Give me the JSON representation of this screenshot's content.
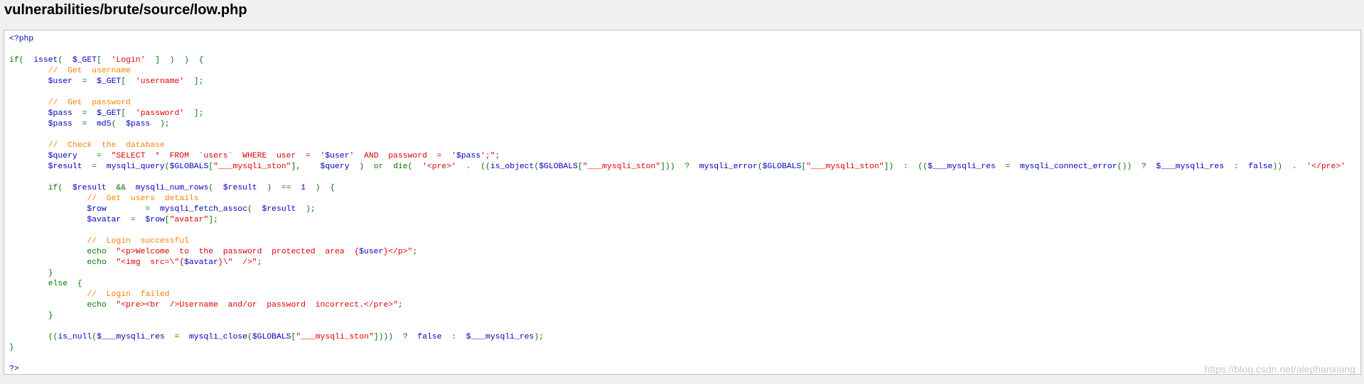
{
  "page": {
    "title": "vulnerabilities/brute/source/low.php"
  },
  "colors": {
    "default": "#0000BB",
    "keyword": "#007700",
    "string": "#DD0000",
    "comment": "#FF8000",
    "background": "#F0F0F0",
    "code_background": "#FFFFFF"
  },
  "code": {
    "lines": [
      [
        [
          "html",
          "&lt;?php"
        ]
      ],
      [],
      [
        [
          "keyword",
          "if(  "
        ],
        [
          "default",
          "isset"
        ],
        [
          "keyword",
          "(  "
        ],
        [
          "default",
          "$_GET"
        ],
        [
          "keyword",
          "[  "
        ],
        [
          "string",
          "'Login'"
        ],
        [
          "keyword",
          "  ]  )  )  {"
        ]
      ],
      [
        [
          "default",
          "        "
        ],
        [
          "comment",
          "//  Get  username"
        ]
      ],
      [
        [
          "default",
          "        $user  "
        ],
        [
          "keyword",
          "=  "
        ],
        [
          "default",
          "$_GET"
        ],
        [
          "keyword",
          "[  "
        ],
        [
          "string",
          "'username'"
        ],
        [
          "keyword",
          "  ];"
        ]
      ],
      [],
      [
        [
          "default",
          "        "
        ],
        [
          "comment",
          "//  Get  password"
        ]
      ],
      [
        [
          "default",
          "        $pass  "
        ],
        [
          "keyword",
          "=  "
        ],
        [
          "default",
          "$_GET"
        ],
        [
          "keyword",
          "[  "
        ],
        [
          "string",
          "'password'"
        ],
        [
          "keyword",
          "  ];"
        ]
      ],
      [
        [
          "default",
          "        $pass  "
        ],
        [
          "keyword",
          "=  "
        ],
        [
          "default",
          "md5"
        ],
        [
          "keyword",
          "(  "
        ],
        [
          "default",
          "$pass  "
        ],
        [
          "keyword",
          ");"
        ]
      ],
      [],
      [
        [
          "default",
          "        "
        ],
        [
          "comment",
          "//  Check  the  database"
        ]
      ],
      [
        [
          "default",
          "        $query    "
        ],
        [
          "keyword",
          "=  "
        ],
        [
          "string",
          "\"SELECT  *  FROM  `users`  WHERE  user  =  '"
        ],
        [
          "default",
          "$user"
        ],
        [
          "string",
          "'  AND  password  =  '"
        ],
        [
          "default",
          "$pass"
        ],
        [
          "string",
          "';\""
        ],
        [
          "keyword",
          ";"
        ]
      ],
      [
        [
          "default",
          "        $result  "
        ],
        [
          "keyword",
          "=  "
        ],
        [
          "default",
          "mysqli_query"
        ],
        [
          "keyword",
          "("
        ],
        [
          "default",
          "$GLOBALS"
        ],
        [
          "keyword",
          "["
        ],
        [
          "string",
          "\"___mysqli_ston\""
        ],
        [
          "keyword",
          "],    "
        ],
        [
          "default",
          "$query  "
        ],
        [
          "keyword",
          ")  or  die(  "
        ],
        [
          "string",
          "'&lt;pre&gt;'  "
        ],
        [
          "keyword",
          ".  (("
        ],
        [
          "default",
          "is_object"
        ],
        [
          "keyword",
          "("
        ],
        [
          "default",
          "$GLOBALS"
        ],
        [
          "keyword",
          "["
        ],
        [
          "string",
          "\"___mysqli_ston\""
        ],
        [
          "keyword",
          "]))  ?  "
        ],
        [
          "default",
          "mysqli_error"
        ],
        [
          "keyword",
          "("
        ],
        [
          "default",
          "$GLOBALS"
        ],
        [
          "keyword",
          "["
        ],
        [
          "string",
          "\"___mysqli_ston\""
        ],
        [
          "keyword",
          "])  :  (("
        ],
        [
          "default",
          "$___mysqli_res  "
        ],
        [
          "keyword",
          "=  "
        ],
        [
          "default",
          "mysqli_connect_error"
        ],
        [
          "keyword",
          "())  ?  "
        ],
        [
          "default",
          "$___mysqli_res  "
        ],
        [
          "keyword",
          ":  "
        ],
        [
          "default",
          "false"
        ],
        [
          "keyword",
          "))  .  "
        ],
        [
          "string",
          "'&lt;/pre&gt;'"
        ]
      ],
      [],
      [
        [
          "default",
          "        "
        ],
        [
          "keyword",
          "if(  "
        ],
        [
          "default",
          "$result  "
        ],
        [
          "keyword",
          "&amp;&amp;  "
        ],
        [
          "default",
          "mysqli_num_rows"
        ],
        [
          "keyword",
          "(  "
        ],
        [
          "default",
          "$result  "
        ],
        [
          "keyword",
          ")  ==  "
        ],
        [
          "default",
          "1  "
        ],
        [
          "keyword",
          ")  {"
        ]
      ],
      [
        [
          "default",
          "                "
        ],
        [
          "comment",
          "//  Get  users  details"
        ]
      ],
      [
        [
          "default",
          "                $row        "
        ],
        [
          "keyword",
          "=  "
        ],
        [
          "default",
          "mysqli_fetch_assoc"
        ],
        [
          "keyword",
          "(  "
        ],
        [
          "default",
          "$result  "
        ],
        [
          "keyword",
          ");"
        ]
      ],
      [
        [
          "default",
          "                $avatar  "
        ],
        [
          "keyword",
          "=  "
        ],
        [
          "default",
          "$row"
        ],
        [
          "keyword",
          "["
        ],
        [
          "string",
          "\"avatar\""
        ],
        [
          "keyword",
          "];"
        ]
      ],
      [],
      [
        [
          "default",
          "                "
        ],
        [
          "comment",
          "//  Login  successful"
        ]
      ],
      [
        [
          "default",
          "                "
        ],
        [
          "keyword",
          "echo  "
        ],
        [
          "string",
          "\"&lt;p&gt;Welcome  to  the  password  protected  area  {"
        ],
        [
          "default",
          "$user"
        ],
        [
          "string",
          "}&lt;/p&gt;\""
        ],
        [
          "keyword",
          ";"
        ]
      ],
      [
        [
          "default",
          "                "
        ],
        [
          "keyword",
          "echo  "
        ],
        [
          "string",
          "\"&lt;img  src=\\\"{"
        ],
        [
          "default",
          "$avatar"
        ],
        [
          "string",
          "}\\\"  /&gt;\""
        ],
        [
          "keyword",
          ";"
        ]
      ],
      [
        [
          "default",
          "        "
        ],
        [
          "keyword",
          "}"
        ]
      ],
      [
        [
          "default",
          "        "
        ],
        [
          "keyword",
          "else  {"
        ]
      ],
      [
        [
          "default",
          "                "
        ],
        [
          "comment",
          "//  Login  failed"
        ]
      ],
      [
        [
          "default",
          "                "
        ],
        [
          "keyword",
          "echo  "
        ],
        [
          "string",
          "\"&lt;pre&gt;&lt;br  /&gt;Username  and/or  password  incorrect.&lt;/pre&gt;\""
        ],
        [
          "keyword",
          ";"
        ]
      ],
      [
        [
          "default",
          "        "
        ],
        [
          "keyword",
          "}"
        ]
      ],
      [],
      [
        [
          "default",
          "        "
        ],
        [
          "keyword",
          "(("
        ],
        [
          "default",
          "is_null"
        ],
        [
          "keyword",
          "("
        ],
        [
          "default",
          "$___mysqli_res  "
        ],
        [
          "keyword",
          "=  "
        ],
        [
          "default",
          "mysqli_close"
        ],
        [
          "keyword",
          "("
        ],
        [
          "default",
          "$GLOBALS"
        ],
        [
          "keyword",
          "["
        ],
        [
          "string",
          "\"___mysqli_ston\""
        ],
        [
          "keyword",
          "])))  ?  "
        ],
        [
          "default",
          "false  "
        ],
        [
          "keyword",
          ":  "
        ],
        [
          "default",
          "$___mysqli_res"
        ],
        [
          "keyword",
          ");"
        ]
      ],
      [
        [
          "keyword",
          "}"
        ]
      ],
      [],
      [
        [
          "html",
          "?&gt;"
        ]
      ]
    ]
  },
  "watermark": {
    "text": "https://blog.csdn.net/alephanxiang"
  }
}
